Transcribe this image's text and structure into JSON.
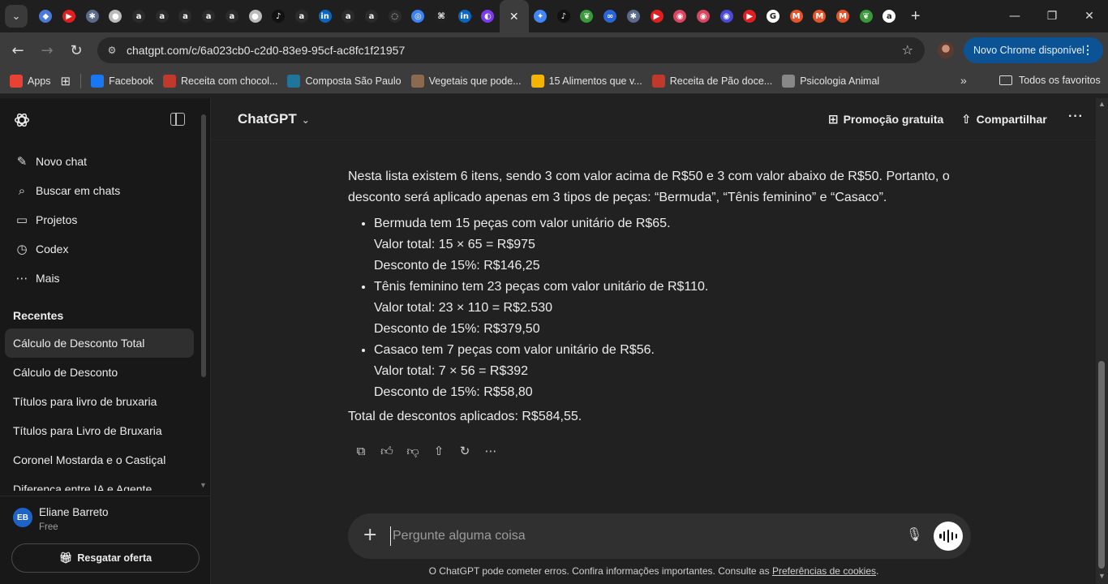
{
  "browser": {
    "tab_favicons": [
      {
        "icon": "shield-icon",
        "color": "#4a7bd8",
        "glyph": "◆"
      },
      {
        "icon": "youtube-icon",
        "color": "#e02020",
        "glyph": "▶"
      },
      {
        "icon": "globe-icon",
        "color": "#5b6b8a",
        "glyph": "✱"
      },
      {
        "icon": "globe-icon",
        "color": "#bbbbbb",
        "glyph": "●"
      },
      {
        "icon": "letter-a-icon",
        "color": "#2b2b2b",
        "glyph": "a"
      },
      {
        "icon": "letter-a-icon",
        "color": "#2b2b2b",
        "glyph": "a"
      },
      {
        "icon": "letter-a-icon",
        "color": "#2b2b2b",
        "glyph": "a"
      },
      {
        "icon": "letter-a-icon",
        "color": "#2b2b2b",
        "glyph": "a"
      },
      {
        "icon": "letter-a-icon",
        "color": "#2b2b2b",
        "glyph": "a"
      },
      {
        "icon": "globe-icon",
        "color": "#bbbbbb",
        "glyph": "●"
      },
      {
        "icon": "tiktok-icon",
        "color": "#111111",
        "glyph": "♪"
      },
      {
        "icon": "letter-a-icon",
        "color": "#2b2b2b",
        "glyph": "a"
      },
      {
        "icon": "linkedin-icon",
        "color": "#0a66c2",
        "glyph": "in"
      },
      {
        "icon": "letter-a-icon",
        "color": "#2b2b2b",
        "glyph": "a"
      },
      {
        "icon": "letter-a-icon",
        "color": "#2b2b2b",
        "glyph": "a"
      },
      {
        "icon": "circle-app-icon",
        "color": "#2b2b2b",
        "glyph": "◌"
      },
      {
        "icon": "blue-circle-icon",
        "color": "#3b82f6",
        "glyph": "◎"
      },
      {
        "icon": "github-icon",
        "color": "#222222",
        "glyph": "⌘"
      },
      {
        "icon": "linkedin-icon",
        "color": "#0a66c2",
        "glyph": "in"
      },
      {
        "icon": "app-icon",
        "color": "#7c3aed",
        "glyph": "◐"
      },
      {
        "icon": "gemini-icon",
        "color": "#4285f4",
        "glyph": "✦"
      },
      {
        "icon": "tiktok-icon",
        "color": "#111111",
        "glyph": "♪"
      },
      {
        "icon": "parrot-icon",
        "color": "#3a9a3a",
        "glyph": "❦"
      },
      {
        "icon": "meta-icon",
        "color": "#2a65d8",
        "glyph": "∞"
      },
      {
        "icon": "react-icon",
        "color": "#5b6b8a",
        "glyph": "✱"
      },
      {
        "icon": "youtube-icon",
        "color": "#e02020",
        "glyph": "▶"
      },
      {
        "icon": "app-icon",
        "color": "#d9465f",
        "glyph": "◉"
      },
      {
        "icon": "app-icon",
        "color": "#d9465f",
        "glyph": "◉"
      },
      {
        "icon": "app-icon",
        "color": "#4a4ad8",
        "glyph": "◉"
      },
      {
        "icon": "youtube-icon",
        "color": "#e02020",
        "glyph": "▶"
      },
      {
        "icon": "google-icon",
        "color": "#ffffff",
        "glyph": "G"
      },
      {
        "icon": "mail-icon",
        "color": "#e8542a",
        "glyph": "M"
      },
      {
        "icon": "mail-icon",
        "color": "#e8542a",
        "glyph": "M"
      },
      {
        "icon": "mail-icon",
        "color": "#e8542a",
        "glyph": "M"
      },
      {
        "icon": "parrot-icon",
        "color": "#3a9a3a",
        "glyph": "❦"
      },
      {
        "icon": "amazon-icon",
        "color": "#ffffff",
        "glyph": "a"
      }
    ],
    "active_tab_index": 20,
    "url": "chatgpt.com/c/6a023cb0-c2d0-83e9-95cf-ac8fc1f21957",
    "update_button": "Novo Chrome disponível",
    "bookmarks": [
      {
        "label": "Apps",
        "icon": "apps-grid-icon",
        "color": "#e94235"
      },
      {
        "label": "Facebook",
        "icon": "facebook-icon",
        "color": "#1877f2"
      },
      {
        "label": "Receita com chocol...",
        "icon": "recipe-icon",
        "color": "#c0392b"
      },
      {
        "label": "Composta São Paulo",
        "icon": "wordpress-icon",
        "color": "#21759b"
      },
      {
        "label": "Vegetais que pode...",
        "icon": "dog-icon",
        "color": "#8b6a4f"
      },
      {
        "label": "15 Alimentos que v...",
        "icon": "food-icon",
        "color": "#f4b400"
      },
      {
        "label": "Receita de Pão doce...",
        "icon": "recipe-icon",
        "color": "#c0392b"
      },
      {
        "label": "Psicologia Animal",
        "icon": "globe-icon",
        "color": "#888888"
      }
    ],
    "bookmarks_folder": "Todos os favoritos"
  },
  "sidebar": {
    "menu": [
      {
        "label": "Novo chat",
        "icon": "edit-icon",
        "glyph": "✎"
      },
      {
        "label": "Buscar em chats",
        "icon": "search-icon",
        "glyph": "⌕"
      },
      {
        "label": "Projetos",
        "icon": "folder-icon",
        "glyph": "▭"
      },
      {
        "label": "Codex",
        "icon": "codex-icon",
        "glyph": "◷"
      },
      {
        "label": "Mais",
        "icon": "more-icon",
        "glyph": "⋯"
      }
    ],
    "recents_title": "Recentes",
    "recents": [
      "Cálculo de Desconto Total",
      "Cálculo de Desconto",
      "Títulos para livro de bruxaria",
      "Títulos para Livro de Bruxaria",
      "Coronel Mostarda e o Castiçal",
      "Diferença entre IA e Agente"
    ],
    "user": {
      "initials": "EB",
      "name": "Eliane Barreto",
      "plan": "Free"
    },
    "offer_button": "Resgatar oferta"
  },
  "header": {
    "model": "ChatGPT",
    "promo": "Promoção gratuita",
    "share": "Compartilhar"
  },
  "answer": {
    "intro": "Nesta lista existem 6 itens, sendo 3 com valor acima de R$50 e 3 com valor abaixo de R$50. Portanto, o desconto será aplicado apenas em 3 tipos de peças: “Bermuda”, “Tênis feminino” e “Casaco”.",
    "items": [
      {
        "line1": "Bermuda tem 15 peças com valor unitário de R$65.",
        "line2": "Valor total: 15 × 65 = R$975",
        "line3": "Desconto de 15%: R$146,25"
      },
      {
        "line1": "Tênis feminino tem 23 peças com valor unitário de R$110.",
        "line2": "Valor total: 23 × 110 = R$2.530",
        "line3": "Desconto de 15%: R$379,50"
      },
      {
        "line1": "Casaco tem 7 peças com valor unitário de R$56.",
        "line2": "Valor total: 7 × 56 = R$392",
        "line3": "Desconto de 15%: R$58,80"
      }
    ],
    "total": "Total de descontos aplicados: R$584,55."
  },
  "composer": {
    "placeholder": "Pergunte alguma coisa"
  },
  "footer": {
    "disclaimer": "O ChatGPT pode cometer erros. Confira informações importantes. Consulte as ",
    "link": "Preferências de cookies",
    "end": "."
  }
}
